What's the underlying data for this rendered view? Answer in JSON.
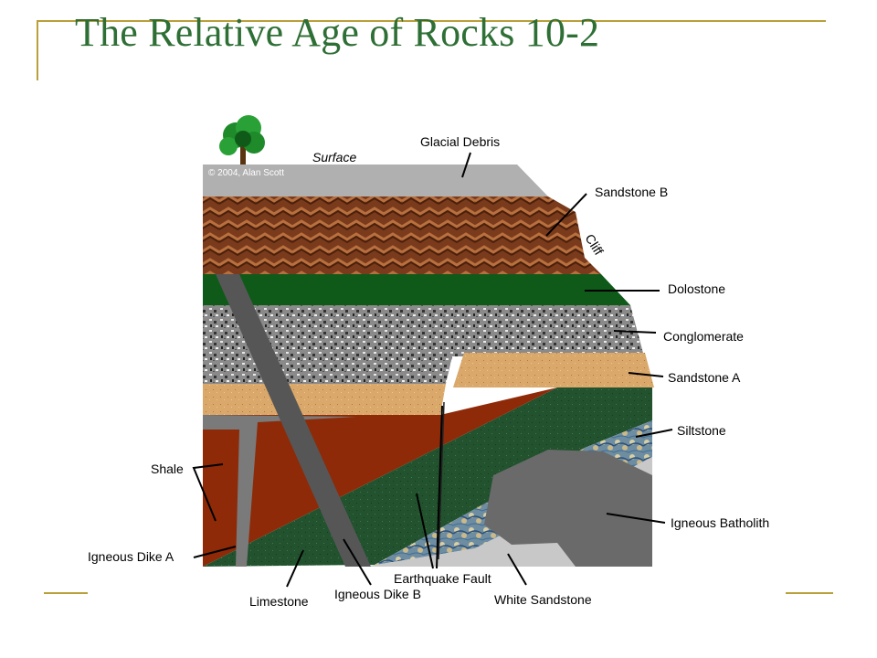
{
  "slide": {
    "title": "The Relative Age of Rocks 10-2"
  },
  "diagram": {
    "copyright": "© 2004, Alan Scott",
    "labels": {
      "surface": "Surface",
      "glacial_debris": "Glacial Debris",
      "sandstone_b": "Sandstone B",
      "cliff": "Cliff",
      "dolostone": "Dolostone",
      "conglomerate": "Conglomerate",
      "sandstone_a": "Sandstone A",
      "siltstone": "Siltstone",
      "igneous_batholith": "Igneous Batholith",
      "shale": "Shale",
      "igneous_dike_a": "Igneous Dike A",
      "limestone": "Limestone",
      "igneous_dike_b": "Igneous Dike B",
      "earthquake_fault": "Earthquake Fault",
      "white_sandstone": "White Sandstone"
    }
  },
  "colors": {
    "title_green": "#2e6f35",
    "accent_gold": "#b9a03a",
    "glacial_debris": "#b0b0b0",
    "sandstone_b": "#7a3a1c",
    "dolostone": "#0f5a18",
    "conglomerate": "#8a8a8a",
    "sandstone_a": "#d9a86a",
    "shale": "#8e2a08",
    "limestone": "#22522e",
    "siltstone": "#6f8da0",
    "igneous": "#6a6a6a",
    "white_sandstone": "#c8c8c8"
  }
}
